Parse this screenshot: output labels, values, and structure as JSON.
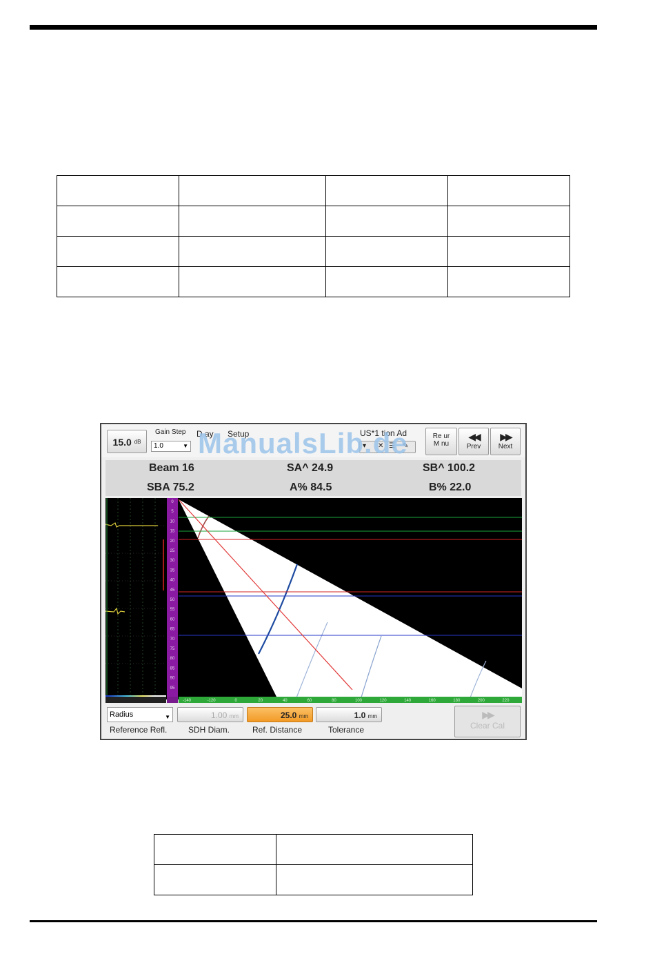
{
  "watermark": "ManualsLib.de",
  "toolbar": {
    "gain_value": "15.0",
    "gain_unit": "dB",
    "gain_step_label": "Gain Step",
    "gain_step_value": "1.0",
    "display_tab": "D  ay",
    "setup_tab": "Setup",
    "wizard_label": "US*1  tion Ad",
    "return_menu_line1": "Re ur",
    "return_menu_line2": "M  nu",
    "prev_label": "Prev",
    "next_label": "Next"
  },
  "readouts": {
    "beam": "Beam 16",
    "sa": "SA^ 24.9",
    "sb": "SB^ 100.2",
    "sba": "SBA 75.2",
    "a_pct": "A% 84.5",
    "b_pct": "B% 22.0"
  },
  "depth_ticks": [
    "0",
    "5",
    "10",
    "15",
    "20",
    "25",
    "30",
    "35",
    "40",
    "45",
    "50",
    "55",
    "60",
    "65",
    "70",
    "75",
    "80",
    "85",
    "90",
    "95"
  ],
  "horizontal_ticks": [
    "-140",
    "-120",
    "0",
    "20",
    "40",
    "60",
    "80",
    "100",
    "120",
    "140",
    "160",
    "180",
    "200",
    "220"
  ],
  "bottom": {
    "reference_select": "Radius",
    "reference_caption": "Reference Refl.",
    "sdh_value": "1.00",
    "sdh_unit": "mm",
    "sdh_caption": "SDH Diam.",
    "ref_distance_value": "25.0",
    "ref_distance_unit": "mm",
    "ref_distance_caption": "Ref. Distance",
    "tolerance_value": "1.0",
    "tolerance_unit": "mm",
    "tolerance_caption": "Tolerance",
    "clear_cal_label": "Clear Cal"
  },
  "colors": {
    "ref_distance_highlight": "#f6a63a",
    "palette_bar": "#8b1aa3",
    "scale_bar": "#2fa83a"
  }
}
